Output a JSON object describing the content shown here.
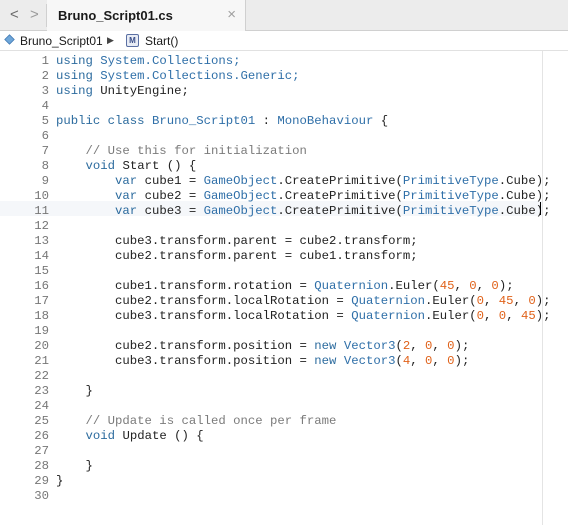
{
  "tabbar": {
    "back": "<",
    "forward": ">",
    "tab_title": "Bruno_Script01.cs",
    "close": "×"
  },
  "jumpbar": {
    "file": "Bruno_Script01",
    "separator": "▶",
    "method_badge": "M",
    "method": "Start()"
  },
  "editor": {
    "current_line": 11,
    "lines": [
      [
        {
          "t": "using",
          "c": "k"
        },
        {
          "t": " System.Collections;",
          "c": "t"
        }
      ],
      [
        {
          "t": "using",
          "c": "k"
        },
        {
          "t": " System.Collections.Generic;",
          "c": "t"
        }
      ],
      [
        {
          "t": "using",
          "c": "k"
        },
        {
          "t": " UnityEngine;",
          "c": "p"
        }
      ],
      [],
      [
        {
          "t": "public class",
          "c": "k"
        },
        {
          "t": " ",
          "c": "p"
        },
        {
          "t": "Bruno_Script01",
          "c": "t"
        },
        {
          "t": " : ",
          "c": "p"
        },
        {
          "t": "MonoBehaviour",
          "c": "t"
        },
        {
          "t": " {",
          "c": "p"
        }
      ],
      [],
      [
        {
          "t": "    // Use this for initialization",
          "c": "c"
        }
      ],
      [
        {
          "t": "    ",
          "c": "p"
        },
        {
          "t": "void",
          "c": "k"
        },
        {
          "t": " Start () {",
          "c": "p"
        }
      ],
      [
        {
          "t": "        ",
          "c": "p"
        },
        {
          "t": "var",
          "c": "k"
        },
        {
          "t": " cube1 = ",
          "c": "p"
        },
        {
          "t": "GameObject",
          "c": "t"
        },
        {
          "t": ".CreatePrimitive(",
          "c": "p"
        },
        {
          "t": "PrimitiveType",
          "c": "t"
        },
        {
          "t": ".Cube);",
          "c": "p"
        }
      ],
      [
        {
          "t": "        ",
          "c": "p"
        },
        {
          "t": "var",
          "c": "k"
        },
        {
          "t": " cube2 = ",
          "c": "p"
        },
        {
          "t": "GameObject",
          "c": "t"
        },
        {
          "t": ".CreatePrimitive(",
          "c": "p"
        },
        {
          "t": "PrimitiveType",
          "c": "t"
        },
        {
          "t": ".Cube);",
          "c": "p"
        }
      ],
      [
        {
          "t": "        ",
          "c": "p"
        },
        {
          "t": "var",
          "c": "k"
        },
        {
          "t": " cube3 = ",
          "c": "p"
        },
        {
          "t": "GameObject",
          "c": "t"
        },
        {
          "t": ".CreatePrimitive(",
          "c": "p"
        },
        {
          "t": "PrimitiveType",
          "c": "t"
        },
        {
          "t": ".Cube);",
          "c": "p"
        }
      ],
      [],
      [
        {
          "t": "        cube3.transform.parent = cube2.transform;",
          "c": "p"
        }
      ],
      [
        {
          "t": "        cube2.transform.parent = cube1.transform;",
          "c": "p"
        }
      ],
      [],
      [
        {
          "t": "        cube1.transform.rotation = ",
          "c": "p"
        },
        {
          "t": "Quaternion",
          "c": "t"
        },
        {
          "t": ".Euler(",
          "c": "p"
        },
        {
          "t": "45",
          "c": "n"
        },
        {
          "t": ", ",
          "c": "p"
        },
        {
          "t": "0",
          "c": "n"
        },
        {
          "t": ", ",
          "c": "p"
        },
        {
          "t": "0",
          "c": "n"
        },
        {
          "t": ");",
          "c": "p"
        }
      ],
      [
        {
          "t": "        cube2.transform.localRotation = ",
          "c": "p"
        },
        {
          "t": "Quaternion",
          "c": "t"
        },
        {
          "t": ".Euler(",
          "c": "p"
        },
        {
          "t": "0",
          "c": "n"
        },
        {
          "t": ", ",
          "c": "p"
        },
        {
          "t": "45",
          "c": "n"
        },
        {
          "t": ", ",
          "c": "p"
        },
        {
          "t": "0",
          "c": "n"
        },
        {
          "t": ");",
          "c": "p"
        }
      ],
      [
        {
          "t": "        cube3.transform.localRotation = ",
          "c": "p"
        },
        {
          "t": "Quaternion",
          "c": "t"
        },
        {
          "t": ".Euler(",
          "c": "p"
        },
        {
          "t": "0",
          "c": "n"
        },
        {
          "t": ", ",
          "c": "p"
        },
        {
          "t": "0",
          "c": "n"
        },
        {
          "t": ", ",
          "c": "p"
        },
        {
          "t": "45",
          "c": "n"
        },
        {
          "t": ");",
          "c": "p"
        }
      ],
      [],
      [
        {
          "t": "        cube2.transform.position = ",
          "c": "p"
        },
        {
          "t": "new",
          "c": "k"
        },
        {
          "t": " ",
          "c": "p"
        },
        {
          "t": "Vector3",
          "c": "t"
        },
        {
          "t": "(",
          "c": "p"
        },
        {
          "t": "2",
          "c": "n"
        },
        {
          "t": ", ",
          "c": "p"
        },
        {
          "t": "0",
          "c": "n"
        },
        {
          "t": ", ",
          "c": "p"
        },
        {
          "t": "0",
          "c": "n"
        },
        {
          "t": ");",
          "c": "p"
        }
      ],
      [
        {
          "t": "        cube3.transform.position = ",
          "c": "p"
        },
        {
          "t": "new",
          "c": "k"
        },
        {
          "t": " ",
          "c": "p"
        },
        {
          "t": "Vector3",
          "c": "t"
        },
        {
          "t": "(",
          "c": "p"
        },
        {
          "t": "4",
          "c": "n"
        },
        {
          "t": ", ",
          "c": "p"
        },
        {
          "t": "0",
          "c": "n"
        },
        {
          "t": ", ",
          "c": "p"
        },
        {
          "t": "0",
          "c": "n"
        },
        {
          "t": ");",
          "c": "p"
        }
      ],
      [],
      [
        {
          "t": "    }",
          "c": "p"
        }
      ],
      [],
      [
        {
          "t": "    // Update is called once per frame",
          "c": "c"
        }
      ],
      [
        {
          "t": "    ",
          "c": "p"
        },
        {
          "t": "void",
          "c": "k"
        },
        {
          "t": " Update () {",
          "c": "p"
        }
      ],
      [],
      [
        {
          "t": "    }",
          "c": "p"
        }
      ],
      [
        {
          "t": "}",
          "c": "p"
        }
      ],
      []
    ]
  }
}
